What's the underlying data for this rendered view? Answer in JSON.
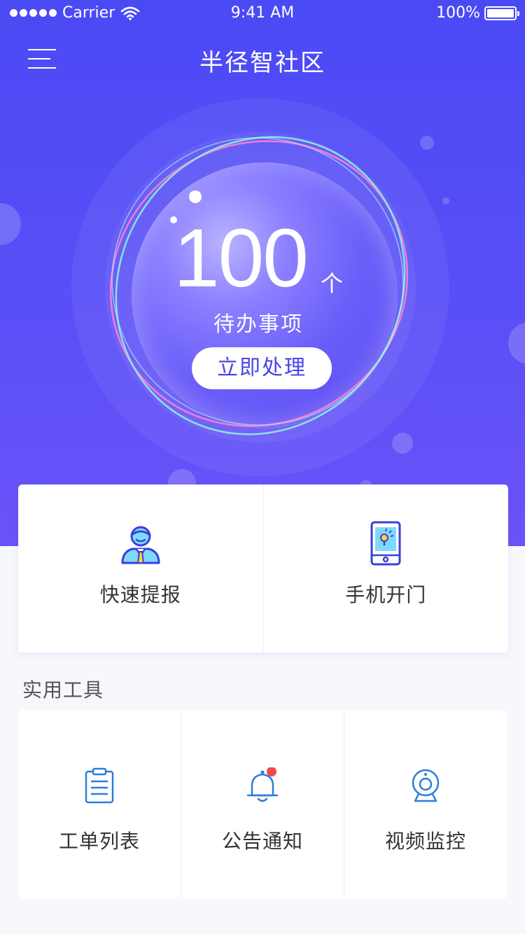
{
  "status_bar": {
    "carrier": "Carrier",
    "time": "9:41 AM",
    "battery": "100%"
  },
  "header": {
    "title": "半径智社区",
    "menu_icon": "hamburger-menu-icon"
  },
  "hero": {
    "count": "100",
    "unit": "个",
    "label": "待办事项",
    "action_label": "立即处理"
  },
  "quick_actions": [
    {
      "label": "快速提报",
      "icon": "staff-person-icon"
    },
    {
      "label": "手机开门",
      "icon": "phone-door-icon"
    }
  ],
  "tools_section": {
    "title": "实用工具",
    "items": [
      {
        "label": "工单列表",
        "icon": "clipboard-list-icon"
      },
      {
        "label": "公告通知",
        "icon": "bell-notification-icon",
        "has_badge": true
      },
      {
        "label": "视频监控",
        "icon": "webcam-icon"
      }
    ]
  },
  "colors": {
    "primary": "#4a4af5",
    "badge": "#f24a4a",
    "icon_blue": "#2f7bdc"
  }
}
